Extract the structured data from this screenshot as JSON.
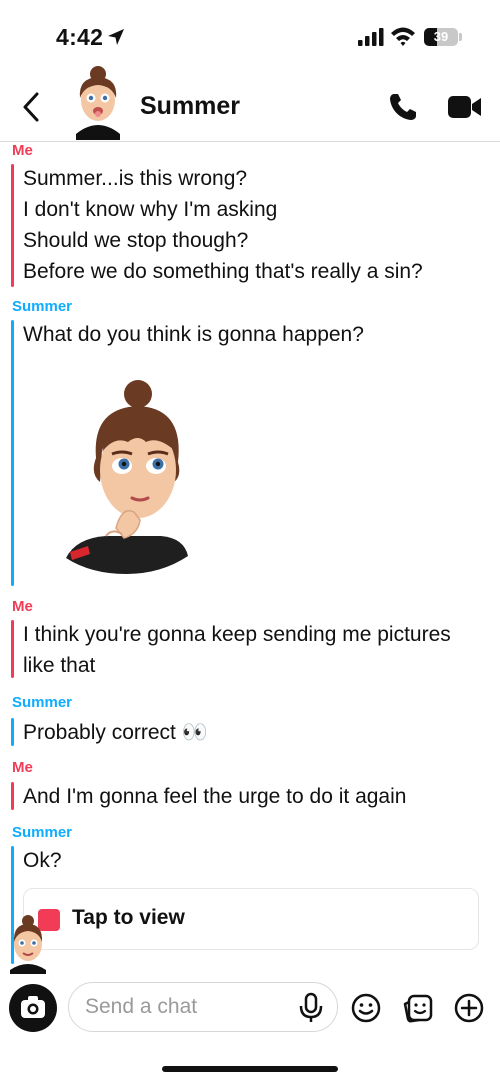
{
  "status_bar": {
    "time": "4:42",
    "battery_level": "39",
    "battery_fraction": 0.39
  },
  "header": {
    "contact_name": "Summer"
  },
  "messages": [
    {
      "sender": "Me",
      "lines": [
        "Summer...is this wrong?",
        "I don't know why I'm asking",
        "Should we stop though?",
        "Before we do something that's really a sin?"
      ]
    },
    {
      "sender": "Summer",
      "lines": [
        "What do you think is gonna happen?"
      ],
      "sticker": "thinking-bitmoji-sticker"
    },
    {
      "sender": "Me",
      "lines": [
        "I think you're gonna keep sending me pictures",
        "like that"
      ]
    },
    {
      "sender": "Summer",
      "lines": [
        "Probably correct 👀"
      ]
    },
    {
      "sender": "Me",
      "lines": [
        "And I'm gonna feel the urge to do it again"
      ]
    },
    {
      "sender": "Summer",
      "lines": [
        "Ok?"
      ],
      "snap": "Tap to view"
    }
  ],
  "input_bar": {
    "placeholder": "Send a chat"
  },
  "icons": {
    "back": "chevron-left-icon",
    "call": "phone-icon",
    "video": "video-camera-icon",
    "camera": "camera-icon",
    "mic": "microphone-icon",
    "emoji": "smiley-icon",
    "sticker": "sticker-icon",
    "plus": "plus-circle-icon"
  },
  "colors": {
    "me": "#f23c57",
    "summer": "#0eadff",
    "snap_square": "#f23c57"
  }
}
